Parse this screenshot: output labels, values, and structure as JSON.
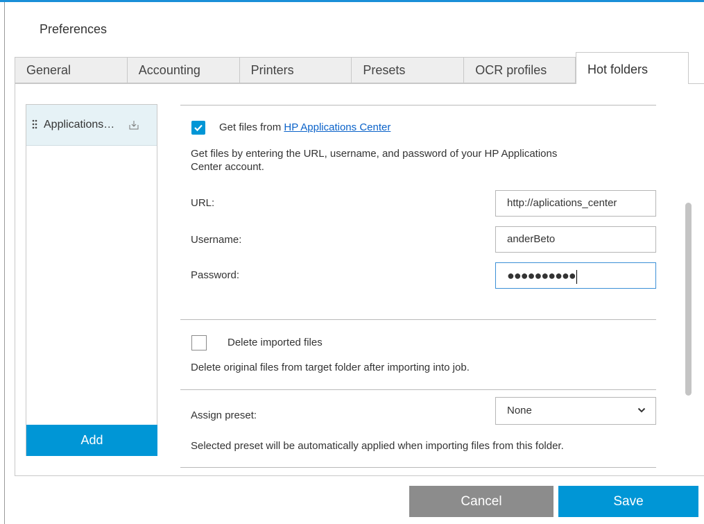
{
  "dialog": {
    "title": "Preferences"
  },
  "tabs": [
    {
      "label": "General"
    },
    {
      "label": "Accounting"
    },
    {
      "label": "Printers"
    },
    {
      "label": "Presets"
    },
    {
      "label": "OCR profiles"
    },
    {
      "label": "Hot folders",
      "active": true
    }
  ],
  "sidebar": {
    "items": [
      {
        "label": "Applications…",
        "icon": "import-icon"
      }
    ],
    "add_label": "Add"
  },
  "get_files": {
    "checked": true,
    "label_prefix": "Get files from",
    "link_text": "HP Applications Center",
    "description_line1": "Get files by entering the URL, username, and password of your HP Applications",
    "description_line2": "Center account."
  },
  "fields": {
    "url": {
      "label": "URL:",
      "value": "http://aplications_center"
    },
    "username": {
      "label": "Username:",
      "value": "anderBeto"
    },
    "password": {
      "label": "Password:",
      "masked_value": "●●●●●●●●●●"
    }
  },
  "delete_files": {
    "checked": false,
    "label": "Delete imported files",
    "description": "Delete original files from target folder after importing into job."
  },
  "assign_preset": {
    "label": "Assign preset:",
    "selected": "None",
    "description": "Selected preset will be automatically applied when importing files from this folder."
  },
  "footer": {
    "cancel_label": "Cancel",
    "save_label": "Save"
  },
  "colors": {
    "accent": "#0096d6",
    "cancel": "#8c8c8c",
    "link": "#0a62c9"
  }
}
